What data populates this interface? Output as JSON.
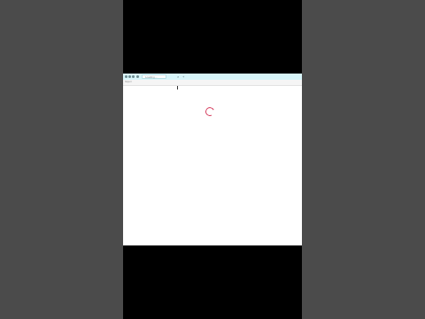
{
  "browser": {
    "tab_title": "Loading…",
    "url": "https://",
    "close_glyph": "×",
    "new_tab_glyph": "+"
  },
  "page": {
    "state": "loading",
    "spinner_icon": "loading-spinner-icon",
    "accent_color": "#d64060",
    "titlebar_color": "#d8f6fb"
  }
}
